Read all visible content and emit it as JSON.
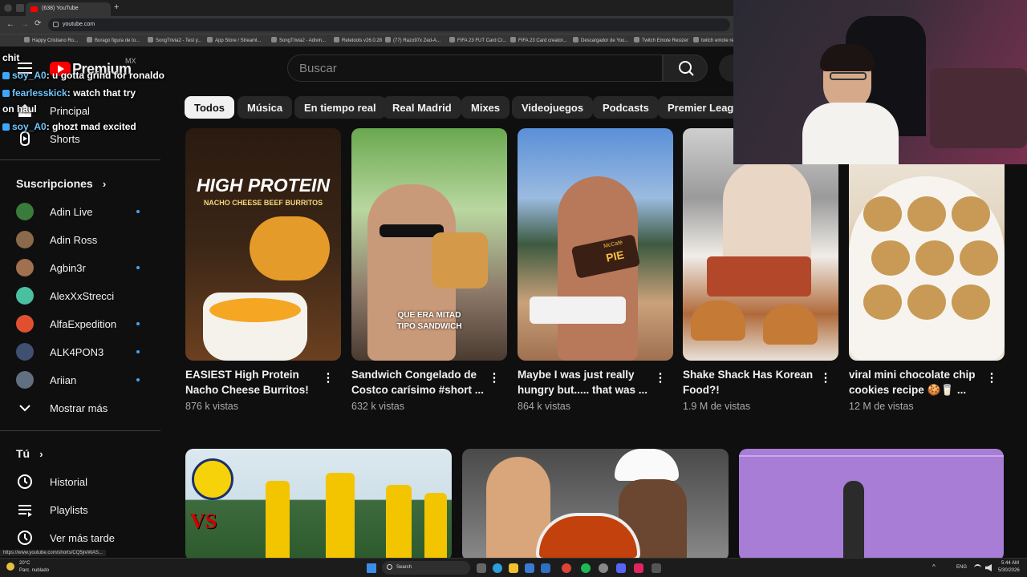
{
  "browser": {
    "tab_title": "(638) YouTube",
    "url": "youtube.com",
    "new_tab_symbol": "+",
    "bookmarks": [
      "Happy Cristiano Ro...",
      "Burago figura de to...",
      "SongTrivia2 - Test y...",
      "App Store / Streaml...",
      "SongTrivia2 - Adivin...",
      "Retetools v26.0.28",
      "(77) Razo97x Zed-A...",
      "FIFA 23 FUT Card Cr...",
      "FIFA 23 Card creator...",
      "Descargador de Yoo...",
      "Twitch Emote Resizer",
      "twitch emote re..."
    ]
  },
  "header": {
    "logo_text": "Premium",
    "region": "MX",
    "search_placeholder": "Buscar"
  },
  "chips": [
    "Todos",
    "Música",
    "En tiempo real",
    "Real Madrid",
    "Mixes",
    "Videojuegos",
    "Podcasts",
    "Premier League"
  ],
  "sidebar": {
    "main": [
      {
        "label": "Principal",
        "icon": "home-icon"
      },
      {
        "label": "Shorts",
        "icon": "shorts-icon"
      }
    ],
    "subscriptions_title": "Suscripciones",
    "subscriptions": [
      {
        "name": "Adin Live",
        "color": "#3a7a3a",
        "new": true
      },
      {
        "name": "Adin Ross",
        "color": "#8a6a4a",
        "new": false
      },
      {
        "name": "Agbin3r",
        "color": "#a07050",
        "new": true
      },
      {
        "name": "AlexXxStrecci",
        "color": "#4ac0a0",
        "new": false
      },
      {
        "name": "AlfaExpedition",
        "color": "#e05030",
        "new": true
      },
      {
        "name": "ALK4PON3",
        "color": "#405070",
        "new": true
      },
      {
        "name": "Ariian",
        "color": "#607080",
        "new": true
      }
    ],
    "show_more": "Mostrar más",
    "you_title": "Tú",
    "you_items": [
      {
        "label": "Historial",
        "icon": "history-icon"
      },
      {
        "label": "Playlists",
        "icon": "playlists-icon"
      },
      {
        "label": "Ver más tarde",
        "icon": "watch-later-icon"
      }
    ]
  },
  "chat": [
    {
      "user": "",
      "text": "chit"
    },
    {
      "user": "soy_A0",
      "text": ": u gotta grind for ronaldo"
    },
    {
      "user": "fearlesskick",
      "text": ": watch that try"
    },
    {
      "user": "",
      "text": "on haul"
    },
    {
      "user": "soy_A0",
      "text": ": ghozt mad excited"
    }
  ],
  "shorts": [
    {
      "title": "EASIEST High Protein Nacho Cheese Burritos! ...",
      "views": "876 k vistas",
      "overlay": "HIGH PROTEIN",
      "overlay_sub": "NACHO CHEESE BEEF BURRITOS"
    },
    {
      "title": "Sandwich Congelado de Costco carísimo #short ...",
      "views": "632 k vistas",
      "overlay": "QUE ERA MITAD",
      "overlay_sub": "TIPO SANDWICH"
    },
    {
      "title": "Maybe I was just really hungry but..... that was ...",
      "views": "864 k vistas",
      "overlay": "PIE",
      "overlay_sub": "McCafé"
    },
    {
      "title": "Shake Shack Has Korean Food?!",
      "views": "1.9 M de vistas",
      "overlay": "",
      "overlay_sub": ""
    },
    {
      "title": "viral mini chocolate chip cookies recipe 🍪🥛 ...",
      "views": "12 M de vistas",
      "overlay": "",
      "overlay_sub": ""
    }
  ],
  "bottom_thumbs": [
    {
      "overlay": "VS"
    },
    {
      "overlay": ""
    },
    {
      "overlay": ""
    }
  ],
  "taskbar": {
    "search": "Search",
    "weather_temp": "20°C",
    "weather_desc": "Parc. nublado",
    "lang": "ENG",
    "time": "5:44 AM",
    "date": "5/30/2026",
    "status_url": "https://www.youtube.com/shorts/CQ5jreWAS..."
  },
  "colors": {
    "background": "#0f0f0f",
    "chip_bg": "#272727",
    "chip_active_bg": "#f1f1f1",
    "new_dot": "#3ea6ff",
    "youtube_red": "#ff0000"
  }
}
